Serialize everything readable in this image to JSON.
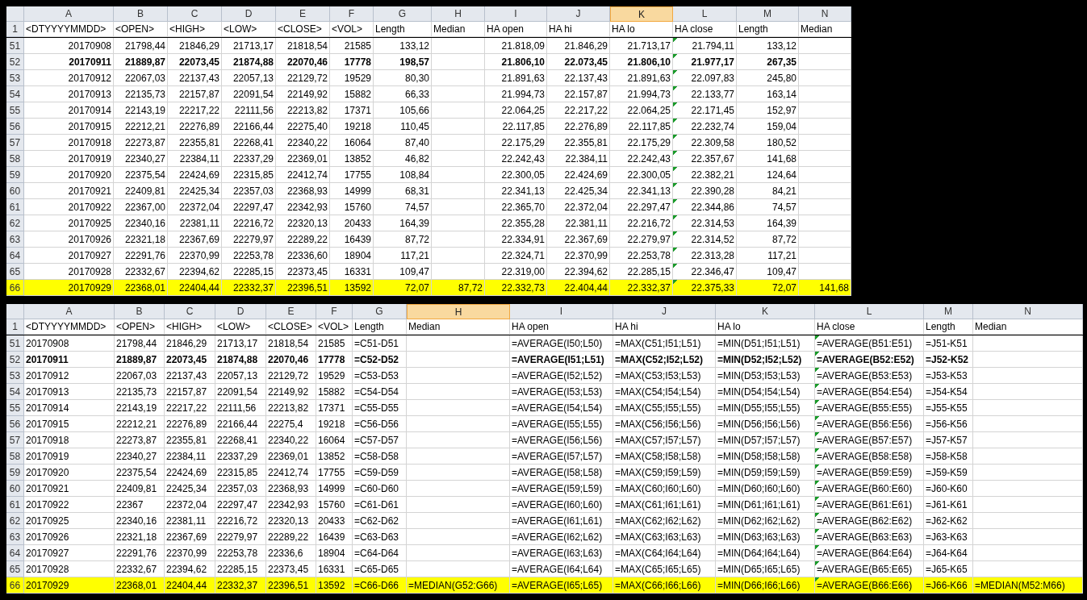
{
  "sheets": [
    {
      "right_align_values": true,
      "columns": [
        {
          "letter": "A",
          "selected": false,
          "flagged": false
        },
        {
          "letter": "B",
          "selected": false,
          "flagged": false
        },
        {
          "letter": "C",
          "selected": false,
          "flagged": false
        },
        {
          "letter": "D",
          "selected": false,
          "flagged": false
        },
        {
          "letter": "E",
          "selected": false,
          "flagged": false
        },
        {
          "letter": "F",
          "selected": false,
          "flagged": false
        },
        {
          "letter": "G",
          "selected": false,
          "flagged": false
        },
        {
          "letter": "H",
          "selected": false,
          "flagged": false
        },
        {
          "letter": "I",
          "selected": false,
          "flagged": false
        },
        {
          "letter": "J",
          "selected": false,
          "flagged": false
        },
        {
          "letter": "K",
          "selected": true,
          "flagged": false
        },
        {
          "letter": "L",
          "selected": false,
          "flagged": true
        },
        {
          "letter": "M",
          "selected": false,
          "flagged": false
        },
        {
          "letter": "N",
          "selected": false,
          "flagged": false
        }
      ],
      "header_row": {
        "number": "1",
        "cells": [
          "<DTYYYYMMDD>",
          "<OPEN>",
          "<HIGH>",
          "<LOW>",
          "<CLOSE>",
          "<VOL>",
          "Length",
          "Median",
          "HA open",
          "HA hi",
          "HA lo",
          "HA close",
          "Length",
          "Median"
        ]
      },
      "rows": [
        {
          "number": "51",
          "bold": false,
          "highlighted": false,
          "cells": [
            "20170908",
            "21798,44",
            "21846,29",
            "21713,17",
            "21818,54",
            "21585",
            "133,12",
            null,
            "21.818,09",
            "21.846,29",
            "21.713,17",
            "21.794,11",
            "133,12",
            null
          ]
        },
        {
          "number": "52",
          "bold": true,
          "highlighted": false,
          "cells": [
            "20170911",
            "21889,87",
            "22073,45",
            "21874,88",
            "22070,46",
            "17778",
            "198,57",
            null,
            "21.806,10",
            "22.073,45",
            "21.806,10",
            "21.977,17",
            "267,35",
            null
          ]
        },
        {
          "number": "53",
          "bold": false,
          "highlighted": false,
          "cells": [
            "20170912",
            "22067,03",
            "22137,43",
            "22057,13",
            "22129,72",
            "19529",
            "80,30",
            null,
            "21.891,63",
            "22.137,43",
            "21.891,63",
            "22.097,83",
            "245,80",
            null
          ]
        },
        {
          "number": "54",
          "bold": false,
          "highlighted": false,
          "cells": [
            "20170913",
            "22135,73",
            "22157,87",
            "22091,54",
            "22149,92",
            "15882",
            "66,33",
            null,
            "21.994,73",
            "22.157,87",
            "21.994,73",
            "22.133,77",
            "163,14",
            null
          ]
        },
        {
          "number": "55",
          "bold": false,
          "highlighted": false,
          "cells": [
            "20170914",
            "22143,19",
            "22217,22",
            "22111,56",
            "22213,82",
            "17371",
            "105,66",
            null,
            "22.064,25",
            "22.217,22",
            "22.064,25",
            "22.171,45",
            "152,97",
            null
          ]
        },
        {
          "number": "56",
          "bold": false,
          "highlighted": false,
          "cells": [
            "20170915",
            "22212,21",
            "22276,89",
            "22166,44",
            "22275,40",
            "19218",
            "110,45",
            null,
            "22.117,85",
            "22.276,89",
            "22.117,85",
            "22.232,74",
            "159,04",
            null
          ]
        },
        {
          "number": "57",
          "bold": false,
          "highlighted": false,
          "cells": [
            "20170918",
            "22273,87",
            "22355,81",
            "22268,41",
            "22340,22",
            "16064",
            "87,40",
            null,
            "22.175,29",
            "22.355,81",
            "22.175,29",
            "22.309,58",
            "180,52",
            null
          ]
        },
        {
          "number": "58",
          "bold": false,
          "highlighted": false,
          "cells": [
            "20170919",
            "22340,27",
            "22384,11",
            "22337,29",
            "22369,01",
            "13852",
            "46,82",
            null,
            "22.242,43",
            "22.384,11",
            "22.242,43",
            "22.357,67",
            "141,68",
            null
          ]
        },
        {
          "number": "59",
          "bold": false,
          "highlighted": false,
          "cells": [
            "20170920",
            "22375,54",
            "22424,69",
            "22315,85",
            "22412,74",
            "17755",
            "108,84",
            null,
            "22.300,05",
            "22.424,69",
            "22.300,05",
            "22.382,21",
            "124,64",
            null
          ]
        },
        {
          "number": "60",
          "bold": false,
          "highlighted": false,
          "cells": [
            "20170921",
            "22409,81",
            "22425,34",
            "22357,03",
            "22368,93",
            "14999",
            "68,31",
            null,
            "22.341,13",
            "22.425,34",
            "22.341,13",
            "22.390,28",
            "84,21",
            null
          ]
        },
        {
          "number": "61",
          "bold": false,
          "highlighted": false,
          "cells": [
            "20170922",
            "22367,00",
            "22372,04",
            "22297,47",
            "22342,93",
            "15760",
            "74,57",
            null,
            "22.365,70",
            "22.372,04",
            "22.297,47",
            "22.344,86",
            "74,57",
            null
          ]
        },
        {
          "number": "62",
          "bold": false,
          "highlighted": false,
          "cells": [
            "20170925",
            "22340,16",
            "22381,11",
            "22216,72",
            "22320,13",
            "20433",
            "164,39",
            null,
            "22.355,28",
            "22.381,11",
            "22.216,72",
            "22.314,53",
            "164,39",
            null
          ]
        },
        {
          "number": "63",
          "bold": false,
          "highlighted": false,
          "cells": [
            "20170926",
            "22321,18",
            "22367,69",
            "22279,97",
            "22289,22",
            "16439",
            "87,72",
            null,
            "22.334,91",
            "22.367,69",
            "22.279,97",
            "22.314,52",
            "87,72",
            null
          ]
        },
        {
          "number": "64",
          "bold": false,
          "highlighted": false,
          "cells": [
            "20170927",
            "22291,76",
            "22370,99",
            "22253,78",
            "22336,60",
            "18904",
            "117,21",
            null,
            "22.324,71",
            "22.370,99",
            "22.253,78",
            "22.313,28",
            "117,21",
            null
          ]
        },
        {
          "number": "65",
          "bold": false,
          "highlighted": false,
          "cells": [
            "20170928",
            "22332,67",
            "22394,62",
            "22285,15",
            "22373,45",
            "16331",
            "109,47",
            null,
            "22.319,00",
            "22.394,62",
            "22.285,15",
            "22.346,47",
            "109,47",
            null
          ]
        },
        {
          "number": "66",
          "bold": false,
          "highlighted": true,
          "cells": [
            "20170929",
            "22368,01",
            "22404,44",
            "22332,37",
            "22396,51",
            "13592",
            "72,07",
            "87,72",
            "22.332,73",
            "22.404,44",
            "22.332,37",
            "22.375,33",
            "72,07",
            "141,68"
          ]
        }
      ]
    },
    {
      "right_align_values": false,
      "columns": [
        {
          "letter": "A",
          "selected": false,
          "flagged": false
        },
        {
          "letter": "B",
          "selected": false,
          "flagged": false
        },
        {
          "letter": "C",
          "selected": false,
          "flagged": false
        },
        {
          "letter": "D",
          "selected": false,
          "flagged": false
        },
        {
          "letter": "E",
          "selected": false,
          "flagged": false
        },
        {
          "letter": "F",
          "selected": false,
          "flagged": false
        },
        {
          "letter": "G",
          "selected": false,
          "flagged": false
        },
        {
          "letter": "H",
          "selected": true,
          "flagged": false
        },
        {
          "letter": "I",
          "selected": false,
          "flagged": false
        },
        {
          "letter": "J",
          "selected": false,
          "flagged": false
        },
        {
          "letter": "K",
          "selected": false,
          "flagged": false
        },
        {
          "letter": "L",
          "selected": false,
          "flagged": true
        },
        {
          "letter": "M",
          "selected": false,
          "flagged": false
        },
        {
          "letter": "N",
          "selected": false,
          "flagged": false
        }
      ],
      "header_row": {
        "number": "1",
        "cells": [
          "<DTYYYYMMDD>",
          "<OPEN>",
          "<HIGH>",
          "<LOW>",
          "<CLOSE>",
          "<VOL>",
          "Length",
          "Median",
          "HA open",
          "HA hi",
          "HA lo",
          "HA close",
          "Length",
          "Median"
        ]
      },
      "rows": [
        {
          "number": "51",
          "bold": false,
          "highlighted": false,
          "cells": [
            "20170908",
            "21798,44",
            "21846,29",
            "21713,17",
            "21818,54",
            "21585",
            "=C51-D51",
            null,
            "=AVERAGE(I50;L50)",
            "=MAX(C51;I51;L51)",
            "=MIN(D51;I51;L51)",
            "=AVERAGE(B51:E51)",
            "=J51-K51",
            null
          ]
        },
        {
          "number": "52",
          "bold": true,
          "highlighted": false,
          "cells": [
            "20170911",
            "21889,87",
            "22073,45",
            "21874,88",
            "22070,46",
            "17778",
            "=C52-D52",
            null,
            "=AVERAGE(I51;L51)",
            "=MAX(C52;I52;L52)",
            "=MIN(D52;I52;L52)",
            "=AVERAGE(B52:E52)",
            "=J52-K52",
            null
          ]
        },
        {
          "number": "53",
          "bold": false,
          "highlighted": false,
          "cells": [
            "20170912",
            "22067,03",
            "22137,43",
            "22057,13",
            "22129,72",
            "19529",
            "=C53-D53",
            null,
            "=AVERAGE(I52;L52)",
            "=MAX(C53;I53;L53)",
            "=MIN(D53;I53;L53)",
            "=AVERAGE(B53:E53)",
            "=J53-K53",
            null
          ]
        },
        {
          "number": "54",
          "bold": false,
          "highlighted": false,
          "cells": [
            "20170913",
            "22135,73",
            "22157,87",
            "22091,54",
            "22149,92",
            "15882",
            "=C54-D54",
            null,
            "=AVERAGE(I53;L53)",
            "=MAX(C54;I54;L54)",
            "=MIN(D54;I54;L54)",
            "=AVERAGE(B54:E54)",
            "=J54-K54",
            null
          ]
        },
        {
          "number": "55",
          "bold": false,
          "highlighted": false,
          "cells": [
            "20170914",
            "22143,19",
            "22217,22",
            "22111,56",
            "22213,82",
            "17371",
            "=C55-D55",
            null,
            "=AVERAGE(I54;L54)",
            "=MAX(C55;I55;L55)",
            "=MIN(D55;I55;L55)",
            "=AVERAGE(B55:E55)",
            "=J55-K55",
            null
          ]
        },
        {
          "number": "56",
          "bold": false,
          "highlighted": false,
          "cells": [
            "20170915",
            "22212,21",
            "22276,89",
            "22166,44",
            "22275,4",
            "19218",
            "=C56-D56",
            null,
            "=AVERAGE(I55;L55)",
            "=MAX(C56;I56;L56)",
            "=MIN(D56;I56;L56)",
            "=AVERAGE(B56:E56)",
            "=J56-K56",
            null
          ]
        },
        {
          "number": "57",
          "bold": false,
          "highlighted": false,
          "cells": [
            "20170918",
            "22273,87",
            "22355,81",
            "22268,41",
            "22340,22",
            "16064",
            "=C57-D57",
            null,
            "=AVERAGE(I56;L56)",
            "=MAX(C57;I57;L57)",
            "=MIN(D57;I57;L57)",
            "=AVERAGE(B57:E57)",
            "=J57-K57",
            null
          ]
        },
        {
          "number": "58",
          "bold": false,
          "highlighted": false,
          "cells": [
            "20170919",
            "22340,27",
            "22384,11",
            "22337,29",
            "22369,01",
            "13852",
            "=C58-D58",
            null,
            "=AVERAGE(I57;L57)",
            "=MAX(C58;I58;L58)",
            "=MIN(D58;I58;L58)",
            "=AVERAGE(B58:E58)",
            "=J58-K58",
            null
          ]
        },
        {
          "number": "59",
          "bold": false,
          "highlighted": false,
          "cells": [
            "20170920",
            "22375,54",
            "22424,69",
            "22315,85",
            "22412,74",
            "17755",
            "=C59-D59",
            null,
            "=AVERAGE(I58;L58)",
            "=MAX(C59;I59;L59)",
            "=MIN(D59;I59;L59)",
            "=AVERAGE(B59:E59)",
            "=J59-K59",
            null
          ]
        },
        {
          "number": "60",
          "bold": false,
          "highlighted": false,
          "cells": [
            "20170921",
            "22409,81",
            "22425,34",
            "22357,03",
            "22368,93",
            "14999",
            "=C60-D60",
            null,
            "=AVERAGE(I59;L59)",
            "=MAX(C60;I60;L60)",
            "=MIN(D60;I60;L60)",
            "=AVERAGE(B60:E60)",
            "=J60-K60",
            null
          ]
        },
        {
          "number": "61",
          "bold": false,
          "highlighted": false,
          "cells": [
            "20170922",
            "22367",
            "22372,04",
            "22297,47",
            "22342,93",
            "15760",
            "=C61-D61",
            null,
            "=AVERAGE(I60;L60)",
            "=MAX(C61;I61;L61)",
            "=MIN(D61;I61;L61)",
            "=AVERAGE(B61:E61)",
            "=J61-K61",
            null
          ]
        },
        {
          "number": "62",
          "bold": false,
          "highlighted": false,
          "cells": [
            "20170925",
            "22340,16",
            "22381,11",
            "22216,72",
            "22320,13",
            "20433",
            "=C62-D62",
            null,
            "=AVERAGE(I61;L61)",
            "=MAX(C62;I62;L62)",
            "=MIN(D62;I62;L62)",
            "=AVERAGE(B62:E62)",
            "=J62-K62",
            null
          ]
        },
        {
          "number": "63",
          "bold": false,
          "highlighted": false,
          "cells": [
            "20170926",
            "22321,18",
            "22367,69",
            "22279,97",
            "22289,22",
            "16439",
            "=C63-D63",
            null,
            "=AVERAGE(I62;L62)",
            "=MAX(C63;I63;L63)",
            "=MIN(D63;I63;L63)",
            "=AVERAGE(B63:E63)",
            "=J63-K63",
            null
          ]
        },
        {
          "number": "64",
          "bold": false,
          "highlighted": false,
          "cells": [
            "20170927",
            "22291,76",
            "22370,99",
            "22253,78",
            "22336,6",
            "18904",
            "=C64-D64",
            null,
            "=AVERAGE(I63;L63)",
            "=MAX(C64;I64;L64)",
            "=MIN(D64;I64;L64)",
            "=AVERAGE(B64:E64)",
            "=J64-K64",
            null
          ]
        },
        {
          "number": "65",
          "bold": false,
          "highlighted": false,
          "cells": [
            "20170928",
            "22332,67",
            "22394,62",
            "22285,15",
            "22373,45",
            "16331",
            "=C65-D65",
            null,
            "=AVERAGE(I64;L64)",
            "=MAX(C65;I65;L65)",
            "=MIN(D65;I65;L65)",
            "=AVERAGE(B65:E65)",
            "=J65-K65",
            null
          ]
        },
        {
          "number": "66",
          "bold": false,
          "highlighted": true,
          "cells": [
            "20170929",
            "22368,01",
            "22404,44",
            "22332,37",
            "22396,51",
            "13592",
            "=C66-D66",
            "=MEDIAN(G52:G66)",
            "=AVERAGE(I65;L65)",
            "=MAX(C66;I66;L66)",
            "=MIN(D66;I66;L66)",
            "=AVERAGE(B66:E66)",
            "=J66-K66",
            "=MEDIAN(M52:M66)"
          ]
        }
      ]
    }
  ]
}
